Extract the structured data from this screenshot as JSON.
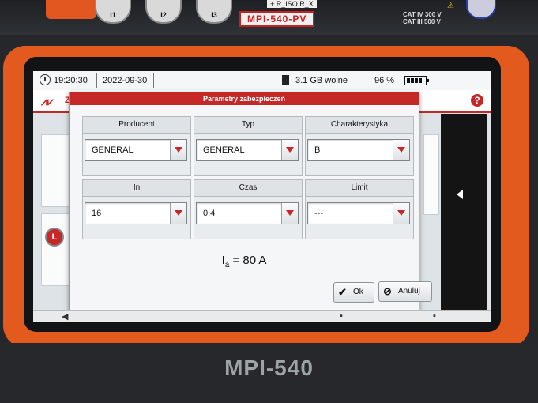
{
  "device": {
    "top_model_label": "MPI-540-PV",
    "riso_label": "+ R_ISO R_X",
    "cat_label_line1": "CAT IV 300 V",
    "cat_label_line2": "CAT III 500 V",
    "connectors": [
      "I1",
      "I2",
      "I3"
    ],
    "brand": "MPI-540"
  },
  "status_bar": {
    "time": "19:20:30",
    "date": "2022-09-30",
    "storage": "3.1 GB wolne",
    "battery": "96 %"
  },
  "app_header": {
    "letter": "Z",
    "help": "?"
  },
  "dialog": {
    "title": "Parametry zabezpieczeń",
    "fields": [
      {
        "label": "Producent",
        "value": "GENERAL"
      },
      {
        "label": "Typ",
        "value": "GENERAL"
      },
      {
        "label": "Charakterystyka",
        "value": "B"
      },
      {
        "label": "In",
        "value": "16"
      },
      {
        "label": "Czas",
        "value": "0.4"
      },
      {
        "label": "Limit",
        "value": "---"
      }
    ],
    "result_symbol": "I",
    "result_subscript": "a",
    "result_value": " = 80 A",
    "ok_label": "Ok",
    "cancel_label": "Anuluj"
  },
  "side_button_label": "L",
  "colors": {
    "accent_red": "#c62828",
    "frame_orange": "#e35a1f"
  }
}
